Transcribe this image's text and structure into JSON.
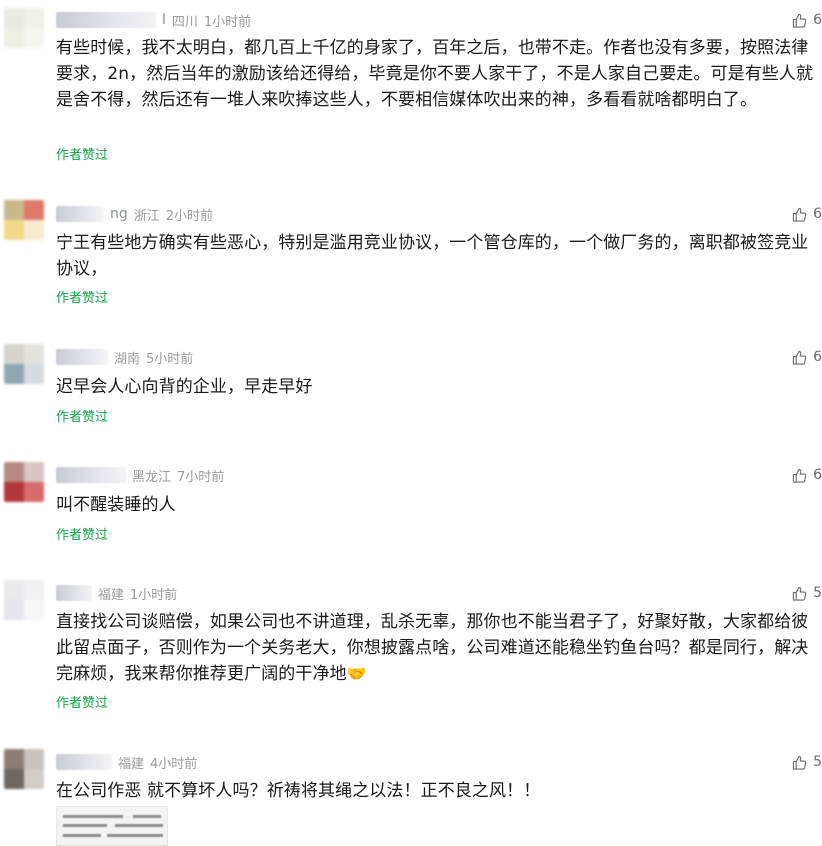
{
  "liked_label": "作者赞过",
  "comments": [
    {
      "username_suffix": "l",
      "location": "四川",
      "time": "1小时前",
      "likes": "6",
      "text": "有些时候，我不太明白，都几百上千亿的身家了，百年之后，也带不走。作者也没有多要，按照法律要求，2n，然后当年的激励该给还得给，毕竟是你不要人家干了，不是人家自己要走。可是有些人就是舍不得，然后还有一堆人来吹捧这些人，不要相信媒体吹出来的神，多看看就啥都明白了。"
    },
    {
      "username_suffix": "ng",
      "location": "浙江",
      "time": "2小时前",
      "likes": "6",
      "text": "宁王有些地方确实有些恶心，特别是滥用竞业协议，一个管仓库的，一个做厂务的，离职都被签竞业协议，"
    },
    {
      "username_suffix": "",
      "location": "湖南",
      "time": "5小时前",
      "likes": "6",
      "text": "迟早会人心向背的企业，早走早好"
    },
    {
      "username_suffix": "",
      "location": "黑龙江",
      "time": "7小时前",
      "likes": "6",
      "text": "叫不醒装睡的人"
    },
    {
      "username_suffix": "",
      "location": "福建",
      "time": "1小时前",
      "likes": "5",
      "text": "直接找公司谈赔偿，如果公司也不讲道理，乱杀无辜，那你也不能当君子了，好聚好散，大家都给彼此留点面子，否则作为一个关务老大，你想披露点啥，公司难道还能稳坐钓鱼台吗？都是同行，解决完麻烦，我来帮你推荐更广阔的干净地",
      "emoji": "🤝"
    },
    {
      "username_suffix": "",
      "location": "福建",
      "time": "4小时前",
      "likes": "5",
      "text": "在公司作恶 就不算坏人吗？祈祷将其绳之以法！正不良之风！！"
    }
  ]
}
